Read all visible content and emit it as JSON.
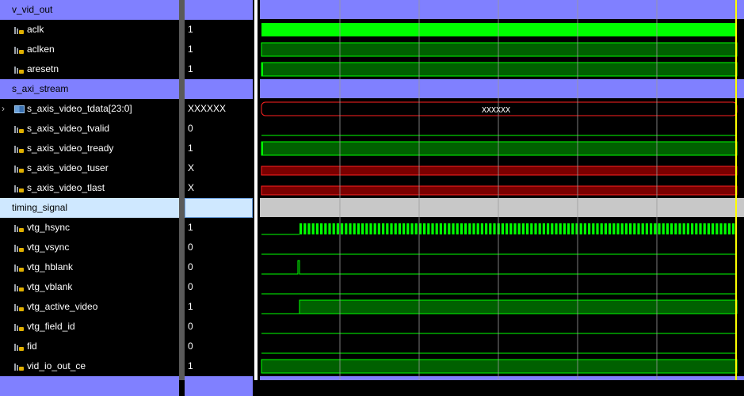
{
  "rows": [
    {
      "kind": "group",
      "name": "v_vid_out",
      "value": ""
    },
    {
      "kind": "signal",
      "name": "aclk",
      "value": "1",
      "wave": "clock",
      "color": "#00ff00"
    },
    {
      "kind": "signal",
      "name": "aclken",
      "value": "1",
      "wave": "high",
      "color": "#00ff00"
    },
    {
      "kind": "signal",
      "name": "aresetn",
      "value": "1",
      "wave": "high",
      "color": "#00ff00"
    },
    {
      "kind": "group",
      "name": "s_axi_stream",
      "value": ""
    },
    {
      "kind": "bus",
      "name": "s_axis_video_tdata[23:0]",
      "value": "XXXXXX",
      "wave": "busx",
      "wave_text": "XXXXXX",
      "color": "#ff2020"
    },
    {
      "kind": "signal",
      "name": "s_axis_video_tvalid",
      "value": "0",
      "wave": "low",
      "color": "#00ff00"
    },
    {
      "kind": "signal",
      "name": "s_axis_video_tready",
      "value": "1",
      "wave": "high",
      "color": "#00ff00"
    },
    {
      "kind": "signal",
      "name": "s_axis_video_tuser",
      "value": "X",
      "wave": "x",
      "color": "#ff2020"
    },
    {
      "kind": "signal",
      "name": "s_axis_video_tlast",
      "value": "X",
      "wave": "x",
      "color": "#ff2020"
    },
    {
      "kind": "group",
      "name": "timing_signal",
      "value": "",
      "selected": true
    },
    {
      "kind": "signal",
      "name": "vtg_hsync",
      "value": "1",
      "wave": "hsync",
      "color": "#00ff00"
    },
    {
      "kind": "signal",
      "name": "vtg_vsync",
      "value": "0",
      "wave": "low",
      "color": "#00ff00"
    },
    {
      "kind": "signal",
      "name": "vtg_hblank",
      "value": "0",
      "wave": "pulse",
      "color": "#00ff00"
    },
    {
      "kind": "signal",
      "name": "vtg_vblank",
      "value": "0",
      "wave": "low",
      "color": "#00ff00"
    },
    {
      "kind": "signal",
      "name": "vtg_active_video",
      "value": "1",
      "wave": "rise",
      "color": "#00ff00"
    },
    {
      "kind": "signal",
      "name": "vtg_field_id",
      "value": "0",
      "wave": "low",
      "color": "#00ff00"
    },
    {
      "kind": "signal",
      "name": "fid",
      "value": "0",
      "wave": "low",
      "color": "#00ff00"
    },
    {
      "kind": "signal",
      "name": "vid_io_out_ce",
      "value": "1",
      "wave": "high",
      "color": "#00ff00"
    },
    {
      "kind": "group",
      "name": "",
      "value": ""
    }
  ],
  "colors": {
    "group_bar": "#8080ff",
    "group_selected": "#cfe8ff",
    "group_selected_wave": "#c8c8c8",
    "signal_fill": "#006000",
    "x_fill": "#7a0000",
    "cursor": "#ffff00",
    "gridline": "#9a9a9a"
  },
  "icons": {
    "signal": "scalar-signal-icon",
    "bus": "bus-signal-icon",
    "expand": "chevron-right-icon"
  }
}
